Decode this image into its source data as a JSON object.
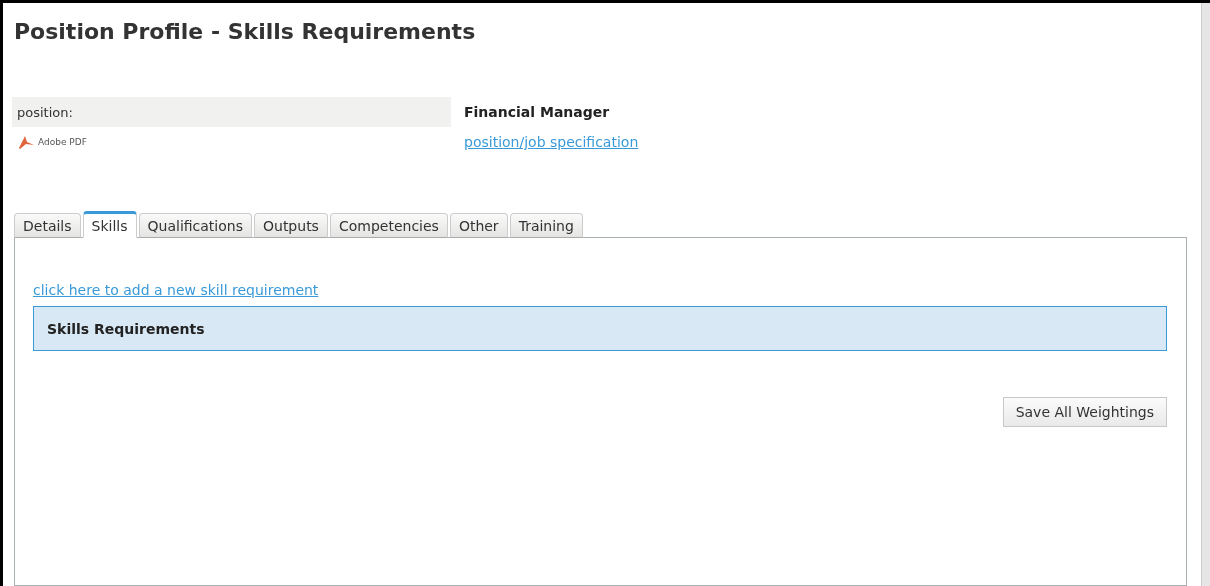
{
  "page": {
    "title": "Position Profile - Skills Requirements"
  },
  "position": {
    "label": "position:",
    "value": "Financial Manager"
  },
  "document": {
    "label": "Adobe PDF",
    "link": "position/job specification"
  },
  "tabs": [
    {
      "label": "Details",
      "selected": false
    },
    {
      "label": "Skills",
      "selected": true
    },
    {
      "label": "Qualifications",
      "selected": false
    },
    {
      "label": "Outputs",
      "selected": false
    },
    {
      "label": "Competencies",
      "selected": false
    },
    {
      "label": "Other",
      "selected": false
    },
    {
      "label": "Training",
      "selected": false
    }
  ],
  "panel": {
    "add_link": "click here to add a new skill requirement",
    "section_header": "Skills Requirements",
    "save_button": "Save All Weightings"
  }
}
